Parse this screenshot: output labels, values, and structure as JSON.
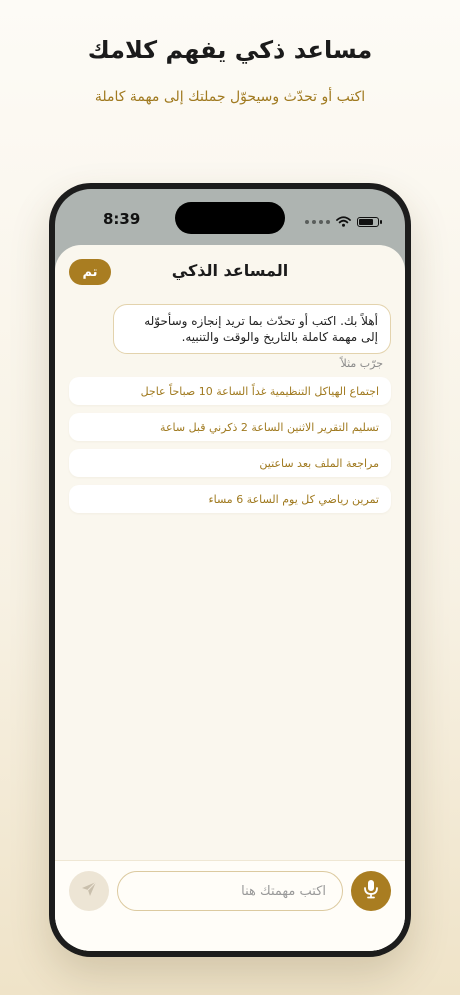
{
  "promo": {
    "headline": "مساعد ذكي يفهم كلامك",
    "subheadline": "اكتب أو تحدّث وسيحوّل جملتك إلى مهمة كاملة"
  },
  "status_bar": {
    "time": "8:39"
  },
  "assistant": {
    "title": "المساعد الذكي",
    "done_label": "تم",
    "welcome_message": "أهلاً بك. اكتب أو تحدّث بما تريد إنجازه وسأحوّله إلى مهمة كاملة بالتاريخ والوقت والتنبيه.",
    "try_label": "جرّب مثلاً",
    "suggestions": [
      "اجتماع الهياكل التنظيمية غداً الساعة 10 صباحاً عاجل",
      "تسليم التقرير الاثنين الساعة 2 ذكرني قبل ساعة",
      "مراجعة الملف بعد ساعتين",
      "تمرين رياضي كل يوم الساعة 6 مساء"
    ],
    "input": {
      "placeholder": "اكتب مهمتك هنا",
      "value": ""
    }
  },
  "icons": {
    "mic": "microphone-icon",
    "send": "send-icon",
    "wifi": "wifi-icon",
    "battery": "battery-icon",
    "signal": "signal-icon"
  },
  "colors": {
    "accent": "#a97d21",
    "sheet_background": "#faf7ee",
    "suggestion_text": "#a07a20"
  }
}
